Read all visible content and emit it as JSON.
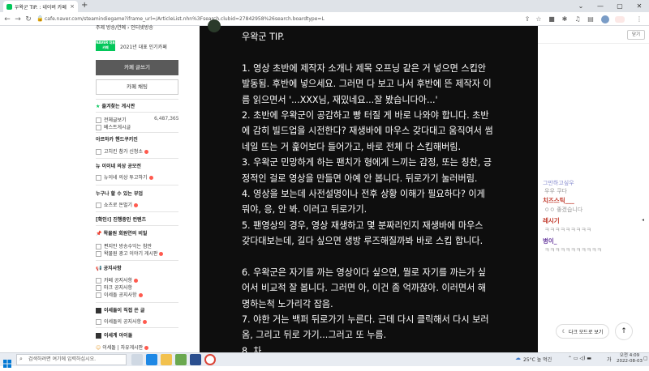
{
  "browser": {
    "tab_title": "우왁군 TIP. : 네이버 카페",
    "tab_close": "×",
    "new_tab": "+",
    "url": "cafe.naver.com/steamindiegame?iframe_url=/ArticleList.nhn%3Fsearch.clubid=27842958%26search.boardtype=L",
    "window_controls": [
      "⌄",
      "—",
      "▢",
      "✕"
    ]
  },
  "left_menu": {
    "top_links": "주제  방송/연예 › 인터넷방송",
    "badge": "NAVER 대표카페",
    "badge_text": "2021년 대표 인기카페",
    "write_button": "카페 글쓰기",
    "chat_button": "카페 채팅",
    "favorites_title": "즐겨찾는 게시판",
    "all_posts": "전체글보기",
    "all_posts_count": "6,487,365",
    "best_posts": "베스트게시글",
    "sections": [
      {
        "title": "아르하카 핸드쿠키진",
        "items": [
          "고치킨 참가 신청소"
        ]
      },
      {
        "title": "뉴 이이네 의상 공모전",
        "items": [
          "뉴이네 의상 투고하기"
        ]
      },
      {
        "title": "누구나 할 수 있는 부업",
        "items": [
          "쇼츠로 돈벌기"
        ]
      },
      {
        "title": "[확인!] 진행중인 컨텐츠",
        "items": []
      },
      {
        "title": "왁물원 회원연의 비밀",
        "items": [
          "편지만 방송수익는 참만",
          "왁물원 광고 이야기 게시판"
        ]
      },
      {
        "title": "공지사항",
        "items": [
          "카페 공지사항",
          "마크 공지사항",
          "이세돌 공지사항"
        ]
      },
      {
        "title": "이세돌이 직접 쓴 글",
        "items": [
          "이세돌의 공지사항"
        ]
      },
      {
        "title": "이세계 아이돌",
        "items": [
          "이세돌 | 자유게시판"
        ]
      }
    ]
  },
  "video": {
    "lines": [
      "우왁군 TIP.",
      "",
      "1. 영상 초반에 제작자 소개나 제목 오프닝 같은 거 넣으면 스킵안",
      "발동됨. 후반에 넣으세요. 그러면 다 보고 나서 후반에 뜬 제작자 이",
      "름 읽으면서 '...XXX님, 재밌네요...잘 봤습니다아...'",
      "2. 초반에 우왁군이 공감하고 빵 터질 게 바로 나와야 합니다. 초반",
      "에 감히 빌드업을 시전한다? 재생바에 마우스 갖다대고 움직여서 썸",
      "네일 뜨는 거 훑어보다 들어가고, 바로 전체 다 스킵해버림.",
      "3. 우왁군 민망하게 하는 팬치가 형에게 느끼는 감정, 또는 칭찬, 긍",
      "정적인 걸로 영상을 만들면 아예 안 봅니다. 뒤로가기 눌러버림.",
      "4. 영상을 보는데 사전설명이나 전후 상황 이해가 필요하다? 이게",
      "뭐야, 응, 안 봐. 이러고 뒤로가기.",
      "5. 팬영상의 경우, 영상 재생하고 몇 분짜리인지 재생바에 마우스",
      "갖다대보는데, 길다 싶으면 생방 루즈해질까봐 바로 스킵 합니다.",
      "",
      "6. 우왁군은 자기를 까는 영상이다 싶으면, 뭘로 자기를 까는가 싶",
      "어서 비교적 잘 봅니다. 그러면 아, 이건 좀 억까잖아. 이러면서 해",
      "명하는척 노가리각 잡음.",
      "7. 야한 거는 백퍼 뒤로가기 누른다. 근데 다시 클릭해서 다시 보러",
      "옴, 그리고 뒤로 가기...그러고 또 누름.",
      "8. 차"
    ]
  },
  "chat": {
    "close_label": "닫기",
    "top_msg": "그만하고싶우",
    "top_msg2": "우우 쿠다",
    "users": [
      {
        "name": "치즈스틱___",
        "msg": "ㅇㅇ 좋겠습니다"
      },
      {
        "name": "레시기",
        "msg": "ㅋㅋㅋㅋㅋㅋㅋㅋㅋ"
      },
      {
        "name": "병이_",
        "msg": "ㅋㅋㅋㅋㅋㅋㅋㅋㅋㅋㅋ"
      }
    ],
    "dark_mode": "다크 모드로 보기",
    "to_top": "↑"
  },
  "taskbar": {
    "search_placeholder": "검색하려면 여기에 입력하십시오.",
    "weather": "25°C 높 먹긴",
    "time": "오전 4:09",
    "date": "2022-08-03",
    "lang": "가"
  },
  "colors": {
    "naver_green": "#03c75a",
    "video_bg": "#0e0e0e",
    "chat_red": "#c0392b",
    "chat_purple": "#6b3fa0"
  }
}
